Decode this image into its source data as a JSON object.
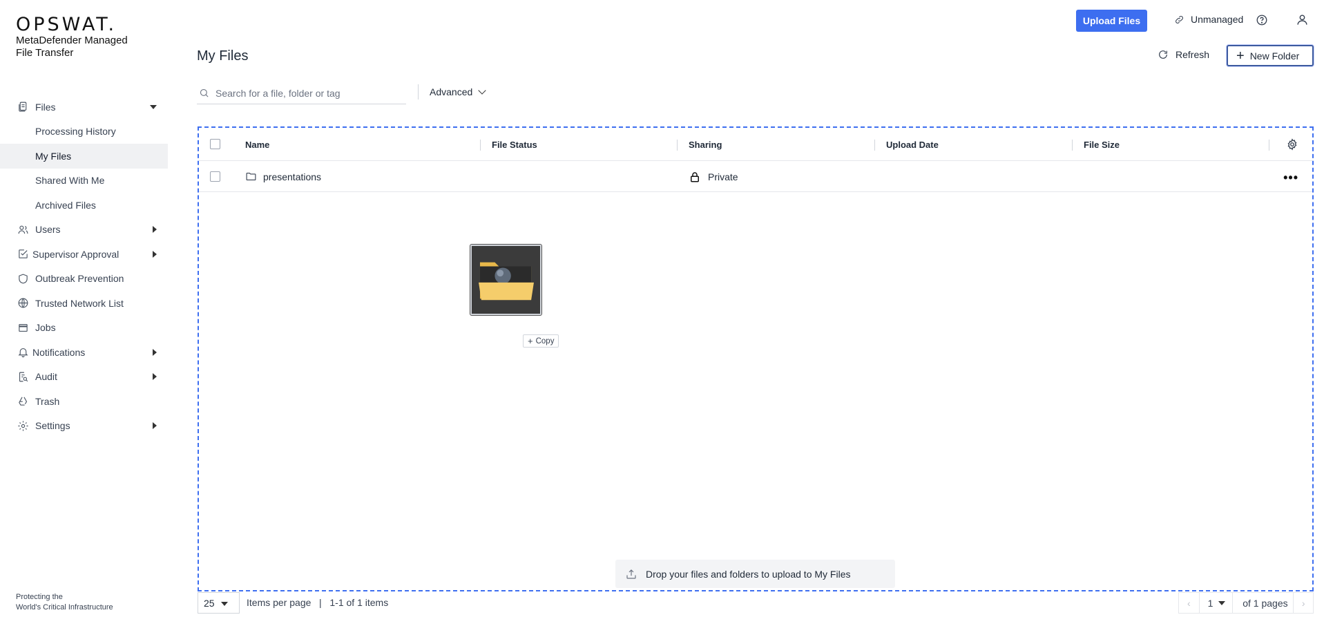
{
  "brand": {
    "logo": "OPSWAT.",
    "product_line1": "MetaDefender Managed",
    "product_line2": "File Transfer",
    "tagline_line1": "Protecting the",
    "tagline_line2": "World's Critical Infrastructure"
  },
  "sidebar": {
    "files": {
      "label": "Files",
      "icon": "files-icon"
    },
    "files_sub": [
      {
        "label": "Processing History"
      },
      {
        "label": "My Files",
        "active": true
      },
      {
        "label": "Shared With Me"
      },
      {
        "label": "Archived Files"
      }
    ],
    "items": [
      {
        "label": "Users",
        "icon": "users-icon",
        "expandable": true
      },
      {
        "label": "Supervisor Approval",
        "icon": "approval-icon",
        "expandable": true
      },
      {
        "label": "Outbreak Prevention",
        "icon": "shield-icon",
        "expandable": false
      },
      {
        "label": "Trusted Network List",
        "icon": "globe-icon",
        "expandable": false
      },
      {
        "label": "Jobs",
        "icon": "jobs-icon",
        "expandable": false
      },
      {
        "label": "Notifications",
        "icon": "bell-icon",
        "expandable": true
      },
      {
        "label": "Audit",
        "icon": "audit-icon",
        "expandable": true
      },
      {
        "label": "Trash",
        "icon": "recycle-icon",
        "expandable": false
      },
      {
        "label": "Settings",
        "icon": "gear-icon",
        "expandable": true
      }
    ]
  },
  "header": {
    "upload_label": "Upload Files",
    "unmanaged_label": "Unmanaged",
    "accent": "#3d6ef0"
  },
  "main": {
    "title": "My Files",
    "refresh_label": "Refresh",
    "new_folder_label": "New Folder",
    "search_placeholder": "Search for a file, folder or tag",
    "advanced_label": "Advanced"
  },
  "table": {
    "columns": [
      "Name",
      "File Status",
      "Sharing",
      "Upload Date",
      "File Size"
    ],
    "rows": [
      {
        "name": "presentations",
        "file_status": "",
        "sharing": "Private",
        "upload_date": "",
        "file_size": ""
      }
    ]
  },
  "drag": {
    "copy_label": "Copy",
    "drop_hint": "Drop your files and folders to upload to My Files"
  },
  "footer": {
    "per_page": "25",
    "items_label": "Items per page",
    "range_label": "1-1 of 1 items",
    "page": "1",
    "of_pages": "of 1 pages"
  }
}
